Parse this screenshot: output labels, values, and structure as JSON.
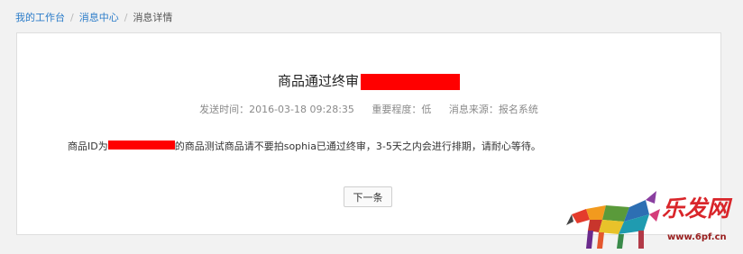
{
  "breadcrumb": {
    "items": [
      "我的工作台",
      "消息中心"
    ],
    "current": "消息详情"
  },
  "message": {
    "title": "商品通过终审",
    "meta": {
      "send_time": "发送时间：2016-03-18 09:28:35",
      "importance": "重要程度：低",
      "source": "消息来源：报名系统"
    },
    "body_prefix": "商品ID为",
    "body_suffix": "的商品测试商品请不要拍sophia已通过终审，3-5天之内会进行排期，请耐心等待。"
  },
  "actions": {
    "next_label": "下一条"
  },
  "watermark": {
    "brand": "乐发网",
    "url": "www.6pf.cn"
  },
  "colors": {
    "link": "#2b7cc9",
    "redaction": "#ff0000",
    "brand": "#d9252a"
  }
}
